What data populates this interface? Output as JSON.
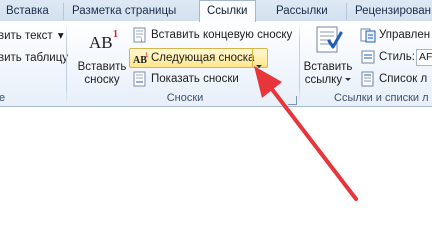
{
  "tabs": [
    {
      "label": "Вставка",
      "active": false
    },
    {
      "label": "Разметка страницы",
      "active": false
    },
    {
      "label": "Ссылки",
      "active": true
    },
    {
      "label": "Рассылки",
      "active": false
    },
    {
      "label": "Рецензирован",
      "active": false
    }
  ],
  "toc_group": {
    "add_text": "вить текст",
    "add_text_arrow": "▾",
    "update_table": "вить таблицу",
    "label": "е"
  },
  "footnotes_group": {
    "insert_footnote": {
      "line1": "Вставить",
      "line2": "сноску"
    },
    "insert_endnote": "Вставить концевую сноску",
    "next_footnote": "Следующая сноска",
    "show_notes": "Показать сноски",
    "label": "Сноски"
  },
  "citations_group": {
    "insert_citation": {
      "line1": "Вставить",
      "line2": "ссылку"
    },
    "manage_sources": "Управлен",
    "style_label": "Стиль:",
    "style_value": "AF",
    "bibliography": "Список л",
    "label": "Ссылки и списки л"
  },
  "colors": {
    "accent": "#1f5fb4",
    "arrow": "#e8343b",
    "highlight": "#ffe68a"
  }
}
